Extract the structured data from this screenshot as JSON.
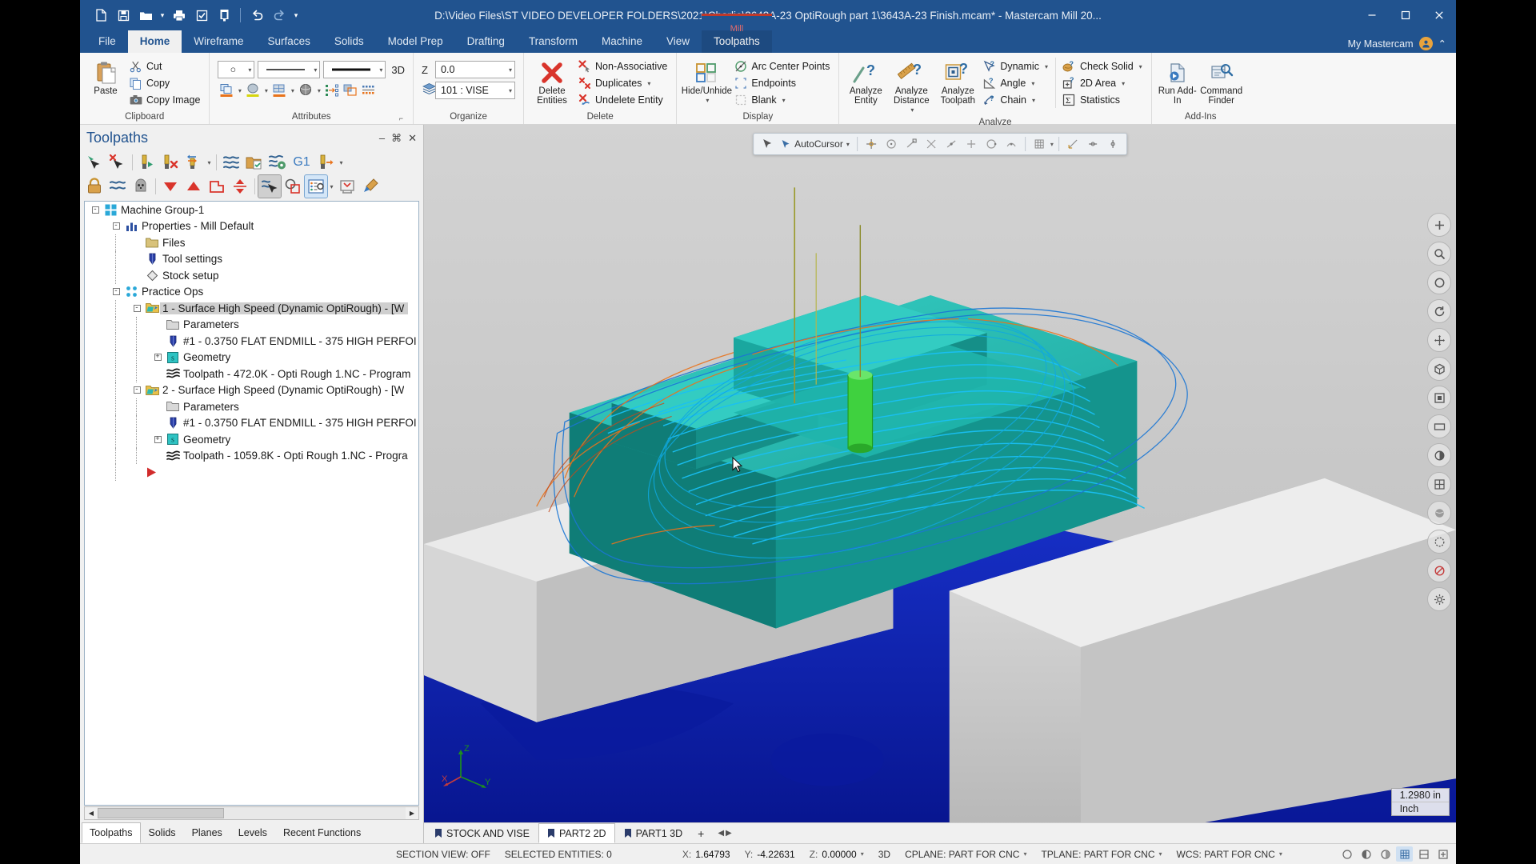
{
  "window": {
    "title": "D:\\Video Files\\ST VIDEO DEVELOPER FOLDERS\\2021\\Charlie\\3643A-23 OptiRough part 1\\3643A-23 Finish.mcam* - Mastercam Mill 20...",
    "minimize": "–",
    "maximize": "❐",
    "close": "✕"
  },
  "qat": {
    "items": [
      {
        "name": "new-file-icon",
        "tip": "New"
      },
      {
        "name": "save-icon",
        "tip": "Save"
      },
      {
        "name": "open-folder-icon",
        "tip": "Open"
      },
      {
        "name": "print-icon",
        "tip": "Print"
      },
      {
        "name": "print-preview-icon",
        "tip": "Print Preview"
      },
      {
        "name": "screen-capture-icon",
        "tip": "Screen Capture"
      },
      {
        "name": "undo-icon",
        "tip": "Undo"
      },
      {
        "name": "redo-icon",
        "tip": "Redo"
      }
    ],
    "customize": "▾"
  },
  "ribbon": {
    "tabs": [
      {
        "label": "File",
        "active": false
      },
      {
        "label": "Home",
        "active": true
      },
      {
        "label": "Wireframe",
        "active": false
      },
      {
        "label": "Surfaces",
        "active": false
      },
      {
        "label": "Solids",
        "active": false
      },
      {
        "label": "Model Prep",
        "active": false
      },
      {
        "label": "Drafting",
        "active": false
      },
      {
        "label": "Transform",
        "active": false
      },
      {
        "label": "Machine",
        "active": false
      },
      {
        "label": "View",
        "active": false
      }
    ],
    "contextual_tab": {
      "label": "Toolpaths",
      "context_label": "Mill"
    },
    "account": "My Mastercam",
    "collapse_caret": "⌃",
    "groups": {
      "clipboard": {
        "label": "Clipboard",
        "paste": "Paste",
        "cut": "Cut",
        "copy": "Copy",
        "copy_image": "Copy Image"
      },
      "attributes": {
        "label": "Attributes",
        "point_style": "○",
        "line_style": "——",
        "line_width": "——",
        "mode_3d": "3D",
        "z_label": "Z",
        "z_value": "0.0",
        "level_value": "101 : VISE"
      },
      "organize": {
        "label": "Organize"
      },
      "delete": {
        "label": "Delete",
        "delete_entities": "Delete Entities",
        "non_associative": "Non-Associative",
        "duplicates": "Duplicates",
        "undelete_entity": "Undelete Entity"
      },
      "display": {
        "label": "Display",
        "hide_unhide": "Hide/Unhide",
        "arc_center_points": "Arc Center Points",
        "endpoints": "Endpoints",
        "blank": "Blank"
      },
      "analyze": {
        "label": "Analyze",
        "analyze_entity": "Analyze Entity",
        "analyze_distance": "Analyze Distance",
        "analyze_toolpath": "Analyze Toolpath",
        "dynamic": "Dynamic",
        "angle": "Angle",
        "chain": "Chain",
        "check_solid": "Check Solid",
        "area_2d": "2D Area",
        "statistics": "Statistics"
      },
      "addins": {
        "label": "Add-Ins",
        "run_addin": "Run Add-In",
        "command_finder": "Command Finder"
      }
    }
  },
  "toolpaths_panel": {
    "title": "Toolpaths",
    "header_buttons": [
      {
        "name": "minimize-panel-icon",
        "glyph": "–"
      },
      {
        "name": "pin-panel-icon",
        "glyph": "⌘"
      },
      {
        "name": "close-panel-icon",
        "glyph": "✕"
      }
    ],
    "toolbar_row1": [
      {
        "name": "select-all-operations-icon"
      },
      {
        "name": "deselect-all-operations-icon"
      },
      {
        "name": "regenerate-selected-icon"
      },
      {
        "name": "regenerate-invalid-icon"
      },
      {
        "name": "regenerate-dirty-icon"
      },
      {
        "name": "toolpath-dropdown-caret"
      },
      {
        "name": "verify-toolpath-icon"
      },
      {
        "name": "backplot-package-icon"
      },
      {
        "name": "simulate-toolpath-icon"
      },
      {
        "name": "g1-post-icon"
      },
      {
        "name": "post-selected-operations-icon"
      }
    ],
    "toolbar_row2": [
      {
        "name": "lock-operation-icon"
      },
      {
        "name": "toggle-toolpath-display-icon"
      },
      {
        "name": "toggle-posting-icon"
      },
      {
        "name": "move-down-icon"
      },
      {
        "name": "move-up-icon"
      },
      {
        "name": "toolpath-group-icon"
      },
      {
        "name": "expand-collapse-icon"
      },
      {
        "name": "select-toolpath-icon"
      },
      {
        "name": "geometry-select-icon"
      },
      {
        "name": "operation-properties-icon"
      },
      {
        "name": "properties-caret"
      },
      {
        "name": "machine-group-icon"
      },
      {
        "name": "paint-toolpath-icon"
      }
    ],
    "g1_label": "G1",
    "tree": [
      {
        "level": 0,
        "label": "Machine Group-1",
        "icon": "machine-group-icon",
        "expander": "-"
      },
      {
        "level": 1,
        "label": "Properties - Mill Default",
        "icon": "properties-icon",
        "expander": "-"
      },
      {
        "level": 2,
        "label": "Files",
        "icon": "files-folder-icon",
        "expander": ""
      },
      {
        "level": 2,
        "label": "Tool settings",
        "icon": "tool-settings-icon",
        "expander": ""
      },
      {
        "level": 2,
        "label": "Stock setup",
        "icon": "stock-setup-icon",
        "expander": ""
      },
      {
        "level": 1,
        "label": "Practice Ops",
        "icon": "toolpath-group-icon",
        "expander": "-"
      },
      {
        "level": 2,
        "label": "1 - Surface High Speed (Dynamic OptiRough) - [W",
        "icon": "operation-folder-icon",
        "expander": "-",
        "selected": true
      },
      {
        "level": 3,
        "label": "Parameters",
        "icon": "parameters-icon",
        "expander": ""
      },
      {
        "level": 3,
        "label": "#1 - 0.3750 FLAT ENDMILL - 375 HIGH PERFOI",
        "icon": "endmill-tool-icon",
        "expander": ""
      },
      {
        "level": 3,
        "label": "Geometry",
        "icon": "geometry-icon",
        "expander": "+"
      },
      {
        "level": 3,
        "label": "Toolpath - 472.0K - Opti Rough 1.NC - Program",
        "icon": "toolpath-icon",
        "expander": ""
      },
      {
        "level": 2,
        "label": "2 - Surface High Speed (Dynamic OptiRough) - [W",
        "icon": "operation-folder-icon",
        "expander": "-"
      },
      {
        "level": 3,
        "label": "Parameters",
        "icon": "parameters-icon",
        "expander": ""
      },
      {
        "level": 3,
        "label": "#1 - 0.3750 FLAT ENDMILL - 375 HIGH PERFOI",
        "icon": "endmill-tool-icon",
        "expander": ""
      },
      {
        "level": 3,
        "label": "Geometry",
        "icon": "geometry-icon",
        "expander": "+"
      },
      {
        "level": 3,
        "label": "Toolpath - 1059.8K - Opti Rough 1.NC - Progra",
        "icon": "toolpath-icon",
        "expander": ""
      },
      {
        "level": 2,
        "label": "",
        "icon": "insert-arrow-icon",
        "expander": ""
      }
    ]
  },
  "viewport": {
    "autocursor": {
      "label": "AutoCursor",
      "caret": "▾",
      "buttons": [
        {
          "name": "autocursor-select-icon"
        },
        {
          "name": "autocursor-origin-icon"
        },
        {
          "name": "autocursor-arc-center-icon"
        },
        {
          "name": "autocursor-endpoint-icon"
        },
        {
          "name": "autocursor-intersection-icon"
        },
        {
          "name": "autocursor-midpoint-icon"
        },
        {
          "name": "autocursor-point-icon"
        },
        {
          "name": "autocursor-quadrant-icon"
        },
        {
          "name": "autocursor-nearest-icon"
        },
        {
          "name": "autocursor-grid-icon"
        },
        {
          "name": "autocursor-grid-caret"
        },
        {
          "name": "autocursor-relative-icon"
        },
        {
          "name": "autocursor-lock-x-icon"
        },
        {
          "name": "autocursor-lock-y-icon"
        }
      ]
    },
    "right_tools": [
      {
        "name": "fit-view-icon",
        "glyph": "+"
      },
      {
        "name": "zoom-window-icon",
        "glyph": "⌕"
      },
      {
        "name": "unzoom-icon",
        "glyph": "○"
      },
      {
        "name": "dynamic-rotate-icon",
        "glyph": "↻"
      },
      {
        "name": "pan-icon",
        "glyph": "✥"
      },
      {
        "name": "isometric-view-icon",
        "glyph": "⬡"
      },
      {
        "name": "top-view-icon",
        "glyph": "▣"
      },
      {
        "name": "front-view-icon",
        "glyph": "▭"
      },
      {
        "name": "shaded-view-icon",
        "glyph": "◑"
      },
      {
        "name": "wireframe-view-icon",
        "glyph": "▦"
      },
      {
        "name": "material-view-icon",
        "glyph": "⬤"
      },
      {
        "name": "translucency-icon",
        "glyph": "◌"
      },
      {
        "name": "section-view-icon",
        "glyph": "⊘"
      },
      {
        "name": "gview-settings-icon",
        "glyph": "⚙"
      }
    ],
    "scale": {
      "value": "1.2980 in",
      "unit": "Inch"
    },
    "gnomon": {
      "x": "X",
      "y": "Y",
      "z": "Z"
    }
  },
  "bottom_tabs": {
    "left": [
      {
        "label": "Toolpaths",
        "active": true
      },
      {
        "label": "Solids",
        "active": false
      },
      {
        "label": "Planes",
        "active": false
      },
      {
        "label": "Levels",
        "active": false
      },
      {
        "label": "Recent Functions",
        "active": false
      }
    ],
    "views": [
      {
        "label": "STOCK AND VISE",
        "active": false
      },
      {
        "label": "PART2 2D",
        "active": true
      },
      {
        "label": "PART1 3D",
        "active": false
      }
    ],
    "add": "+",
    "nav_prev": "◀",
    "nav_next": "▶"
  },
  "statusbar": {
    "section_view": "SECTION VIEW: OFF",
    "selected_entities": "SELECTED ENTITIES: 0",
    "x_label": "X:",
    "x_value": "1.64793",
    "y_label": "Y:",
    "y_value": "-4.22631",
    "z_label": "Z:",
    "z_value": "0.00000",
    "mode": "3D",
    "cplane": "CPLANE: PART FOR CNC",
    "tplane": "TPLANE: PART FOR CNC",
    "wcs": "WCS: PART FOR CNC",
    "right_icons": [
      {
        "name": "status-wireframe-icon",
        "glyph": "○"
      },
      {
        "name": "status-shaded-icon",
        "glyph": "◐"
      },
      {
        "name": "status-translucent-icon",
        "glyph": "◑"
      },
      {
        "name": "status-display-grid-icon",
        "glyph": "▦",
        "on": true
      },
      {
        "name": "status-material-icon",
        "glyph": "▧"
      },
      {
        "name": "status-fit-icon",
        "glyph": "⊞"
      }
    ]
  },
  "colors": {
    "ribbon_blue": "#21538f",
    "accent_orange": "#e8731c",
    "teal_part": "#1fa9a0",
    "blue_fixture": "#0a1fb0",
    "toolpath_cyan": "#14b3e8",
    "tool_green": "#3fd13f"
  }
}
